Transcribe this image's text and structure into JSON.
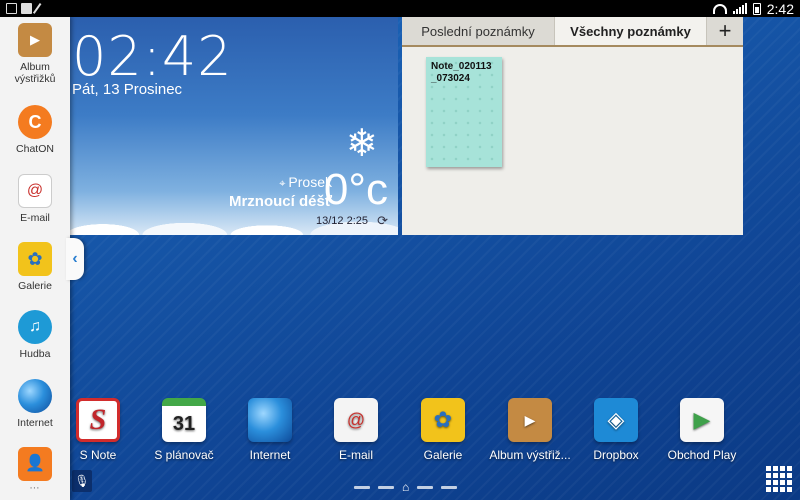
{
  "status_bar": {
    "time": "2:42"
  },
  "side_panel": {
    "items": [
      {
        "label": "Album výstřižků",
        "icon": "album-icon"
      },
      {
        "label": "ChatON",
        "icon": "chaton-icon"
      },
      {
        "label": "E-mail",
        "icon": "email-icon"
      },
      {
        "label": "Galerie",
        "icon": "gallery-icon"
      },
      {
        "label": "Hudba",
        "icon": "music-icon"
      },
      {
        "label": "Internet",
        "icon": "globe-icon"
      }
    ],
    "more": "⋯"
  },
  "clock_widget": {
    "time": "02:42",
    "date": "Pát, 13 Prosinec",
    "location": "Prosek",
    "temperature": "0°c",
    "condition": "Mrznoucí déšť",
    "updated": "13/12 2:25"
  },
  "notes_widget": {
    "tabs": [
      "Poslední poznámky",
      "Všechny poznámky"
    ],
    "add_label": "+",
    "note_title": "Note_020113_073024"
  },
  "dock": [
    {
      "label": "S Note",
      "glyph": "S",
      "icon": "snote-icon"
    },
    {
      "label": "S plánovač",
      "glyph": "31",
      "icon": "calendar-icon"
    },
    {
      "label": "Internet",
      "glyph": "",
      "icon": "globe-icon"
    },
    {
      "label": "E-mail",
      "glyph": "@",
      "icon": "email-icon"
    },
    {
      "label": "Galerie",
      "glyph": "✿",
      "icon": "gallery-icon"
    },
    {
      "label": "Album výstřiž...",
      "glyph": "▶",
      "icon": "album-icon"
    },
    {
      "label": "Dropbox",
      "glyph": "◈",
      "icon": "dropbox-icon"
    },
    {
      "label": "Obchod Play",
      "glyph": "▶",
      "icon": "play-store-icon"
    }
  ],
  "colors": {
    "wallpaper": "#1656a8",
    "note": "#a7e3d9",
    "tab_accent": "#a58a5f"
  }
}
